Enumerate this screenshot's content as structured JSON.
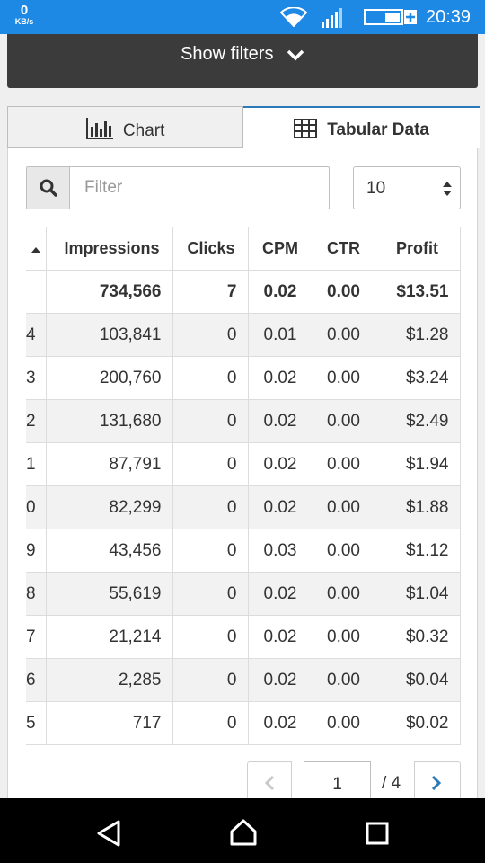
{
  "status_bar": {
    "speed_value": "0",
    "speed_unit": "KB/s",
    "time": "20:39",
    "icons": [
      "wifi-icon",
      "signal-icon",
      "battery-icon"
    ]
  },
  "filters": {
    "label": "Show filters",
    "icon": "chevron-down-icon"
  },
  "tabs": [
    {
      "label": "Chart",
      "icon": "bar-chart-icon",
      "active": false
    },
    {
      "label": "Tabular Data",
      "icon": "table-icon",
      "active": true
    }
  ],
  "search": {
    "placeholder": "Filter",
    "value": "",
    "icon": "search-icon"
  },
  "page_size": {
    "selected": "10",
    "icon": "updown-arrows-icon"
  },
  "table": {
    "sort_icon": "sort-up-icon",
    "headers": [
      "Impressions",
      "Clicks",
      "CPM",
      "CTR",
      "Profit"
    ],
    "total": [
      "",
      "734,566",
      "7",
      "0.02",
      "0.00",
      "$13.51"
    ],
    "rows": [
      [
        "4",
        "103,841",
        "0",
        "0.01",
        "0.00",
        "$1.28"
      ],
      [
        "3",
        "200,760",
        "0",
        "0.02",
        "0.00",
        "$3.24"
      ],
      [
        "2",
        "131,680",
        "0",
        "0.02",
        "0.00",
        "$2.49"
      ],
      [
        "1",
        "87,791",
        "0",
        "0.02",
        "0.00",
        "$1.94"
      ],
      [
        "0",
        "82,299",
        "0",
        "0.02",
        "0.00",
        "$1.88"
      ],
      [
        "9",
        "43,456",
        "0",
        "0.03",
        "0.00",
        "$1.12"
      ],
      [
        "8",
        "55,619",
        "0",
        "0.02",
        "0.00",
        "$1.04"
      ],
      [
        "7",
        "21,214",
        "0",
        "0.02",
        "0.00",
        "$0.32"
      ],
      [
        "6",
        "2,285",
        "0",
        "0.02",
        "0.00",
        "$0.04"
      ],
      [
        "5",
        "717",
        "0",
        "0.02",
        "0.00",
        "$0.02"
      ]
    ]
  },
  "pagination": {
    "current_page": "1",
    "total_label": "/ 4",
    "prev_icon": "chevron-left-icon",
    "next_icon": "chevron-right-icon"
  },
  "nav_bar": {
    "buttons": [
      "back-icon",
      "home-icon",
      "recents-icon"
    ]
  },
  "colors": {
    "status_bar": "#1e88e5",
    "filters_bar": "#3b3b3b",
    "accent": "#2b7bb9"
  }
}
